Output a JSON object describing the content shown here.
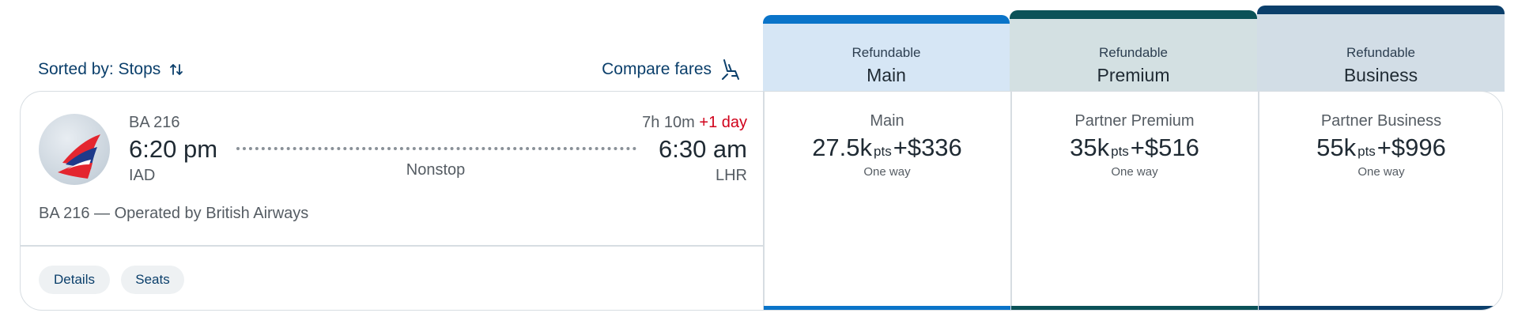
{
  "toolbar": {
    "sort_label": "Sorted by: Stops",
    "compare_label": "Compare fares"
  },
  "flight": {
    "flight_number": "BA 216",
    "departure_time": "6:20 pm",
    "departure_airport": "IAD",
    "stops": "Nonstop",
    "duration": "7h 10m",
    "day_offset": "+1 day",
    "arrival_time": "6:30 am",
    "arrival_airport": "LHR",
    "operated_by": "BA 216 — Operated by British Airways",
    "details_label": "Details",
    "seats_label": "Seats"
  },
  "fare_headers": [
    {
      "refundable": "Refundable",
      "class": "Main",
      "accent": "#0a74c9",
      "bg": "#d6e6f5"
    },
    {
      "refundable": "Refundable",
      "class": "Premium",
      "accent": "#0b5258",
      "bg": "#d3e0e2"
    },
    {
      "refundable": "Refundable",
      "class": "Business",
      "accent": "#0b3f6b",
      "bg": "#d2dde6"
    }
  ],
  "fares": [
    {
      "name": "Main",
      "points": "27.5k",
      "pts_unit": "pts",
      "plus": "+",
      "cash": "$336",
      "trip": "One way"
    },
    {
      "name": "Partner Premium",
      "points": "35k",
      "pts_unit": "pts",
      "plus": "+",
      "cash": "$516",
      "trip": "One way"
    },
    {
      "name": "Partner Business",
      "points": "55k",
      "pts_unit": "pts",
      "plus": "+",
      "cash": "$996",
      "trip": "One way"
    }
  ]
}
